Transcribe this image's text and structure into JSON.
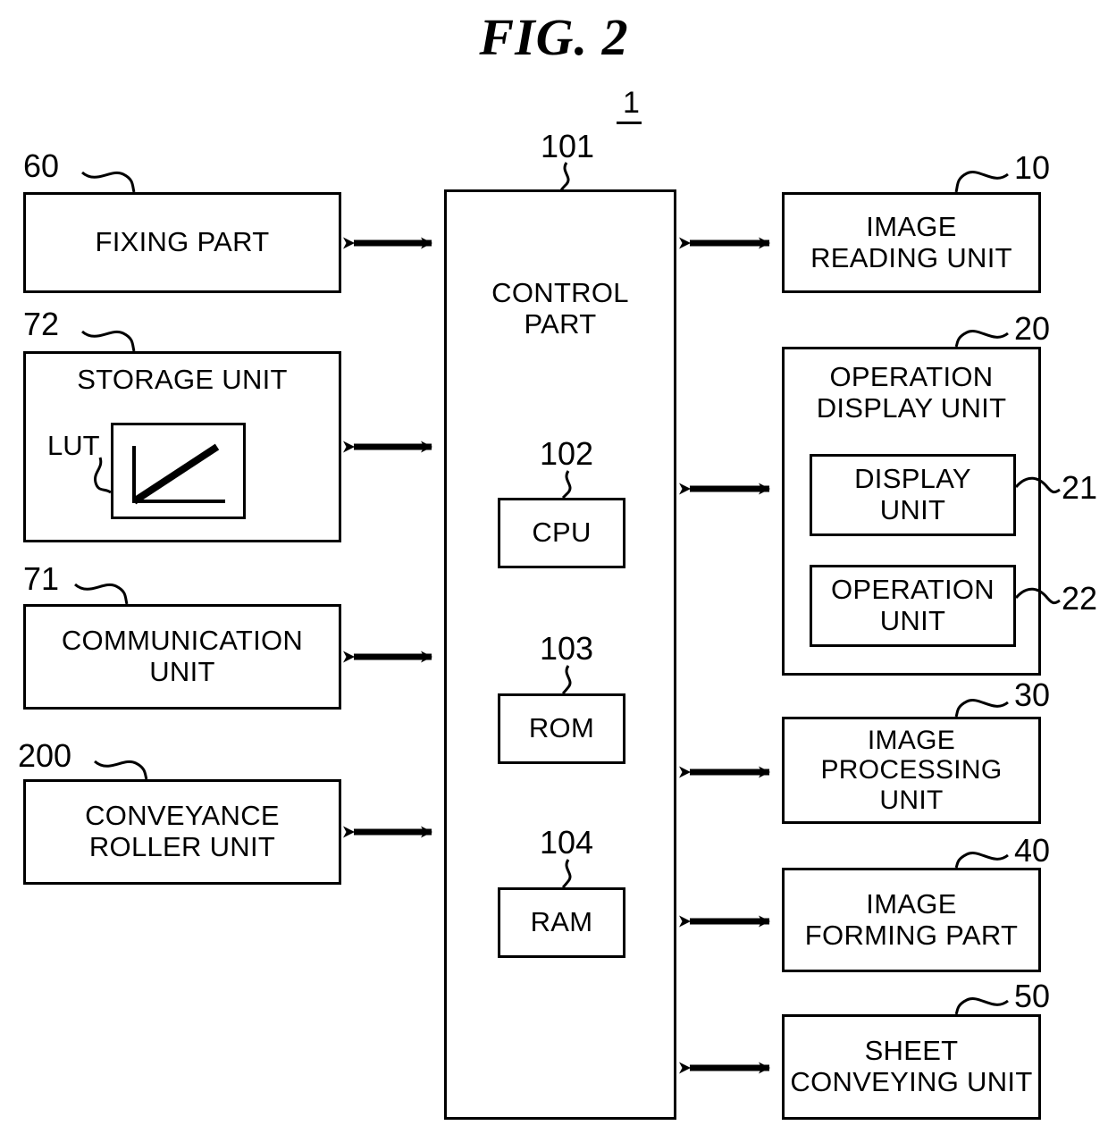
{
  "figure": {
    "title": "FIG. 2",
    "system_ref": "1",
    "center": {
      "ref": "101",
      "label": "CONTROL\nPART",
      "modules": [
        {
          "ref": "102",
          "label": "CPU"
        },
        {
          "ref": "103",
          "label": "ROM"
        },
        {
          "ref": "104",
          "label": "RAM"
        }
      ]
    },
    "left_blocks": [
      {
        "ref": "60",
        "label": "FIXING PART"
      },
      {
        "ref": "72",
        "label": "STORAGE UNIT",
        "sub_label": "LUT",
        "has_lut_graph": true
      },
      {
        "ref": "71",
        "label": "COMMUNICATION\nUNIT"
      },
      {
        "ref": "200",
        "label": "CONVEYANCE\nROLLER UNIT"
      }
    ],
    "right_blocks": [
      {
        "ref": "10",
        "label": "IMAGE\nREADING UNIT"
      },
      {
        "ref": "20",
        "label": "OPERATION\nDISPLAY UNIT",
        "children": [
          {
            "ref": "21",
            "label": "DISPLAY\nUNIT"
          },
          {
            "ref": "22",
            "label": "OPERATION\nUNIT"
          }
        ]
      },
      {
        "ref": "30",
        "label": "IMAGE\nPROCESSING\nUNIT"
      },
      {
        "ref": "40",
        "label": "IMAGE\nFORMING PART"
      },
      {
        "ref": "50",
        "label": "SHEET\nCONVEYING UNIT"
      }
    ],
    "connector_style": "double-headed-arrow",
    "colors": {
      "stroke": "#000000",
      "background": "#ffffff"
    }
  }
}
